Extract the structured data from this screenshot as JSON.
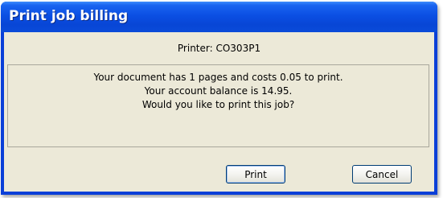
{
  "window": {
    "title": "Print job billing"
  },
  "printer_line": "Printer: CO303P1",
  "message": {
    "line1": "Your document has 1 pages and costs 0.05 to print.",
    "line2": "Your account balance is 14.95.",
    "line3": "Would you like to print this job?"
  },
  "buttons": {
    "print_label": "Print",
    "cancel_label": "Cancel"
  },
  "colors": {
    "titlebar": "#0a4bd9",
    "client_bg": "#ece9d8"
  }
}
